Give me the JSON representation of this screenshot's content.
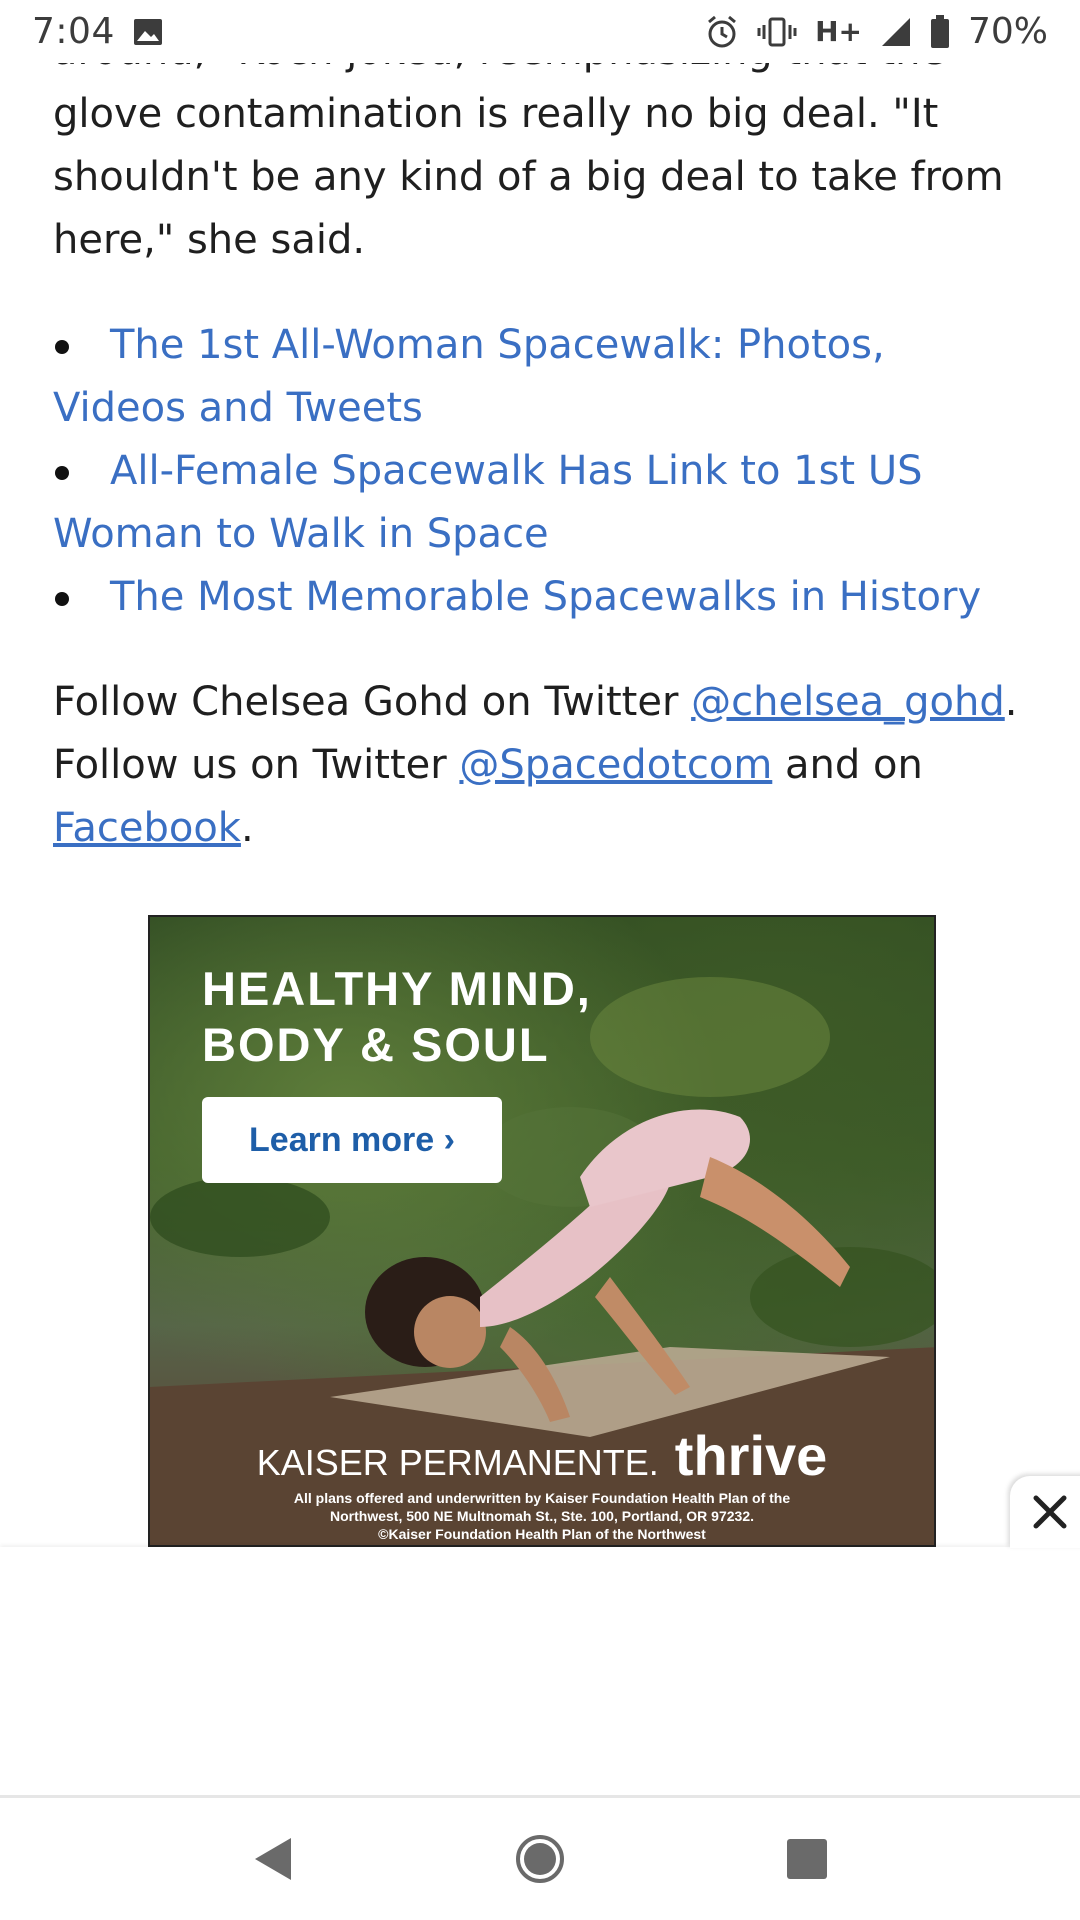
{
  "status_bar": {
    "time": "7:04",
    "battery_percent": "70%",
    "network_label": "H+",
    "icons": [
      "image-icon",
      "alarm-icon",
      "vibrate-icon",
      "signal-icon",
      "battery-icon"
    ]
  },
  "article": {
    "cut_line": "around,\" Koch joked, reemphasizing that the",
    "paragraph_1": "glove contamination is really no big deal. \"It shouldn't be any kind of a big deal to take from here,\" she said.",
    "related_links": [
      "The 1st All-Woman Spacewalk: Photos, Videos and Tweets",
      "All-Female Spacewalk Has Link to 1st US Woman to Walk in Space",
      "The Most Memorable Spacewalks in History"
    ],
    "follow": {
      "prefix_1": "Follow Chelsea Gohd on Twitter ",
      "handle_1": "@chelsea_gohd",
      "suffix_1": ".",
      "prefix_2": " Follow us on Twitter ",
      "handle_2": "@Spacedotcom",
      "middle_2": " and on ",
      "facebook": "Facebook",
      "suffix_2": "."
    }
  },
  "ad": {
    "headline_1": "HEALTHY MIND,",
    "headline_2": "BODY & SOUL",
    "cta_label": "Learn more ›",
    "brand": "KAISER PERMANENTE.",
    "brand_tagline": "thrive",
    "legal_1": "All plans offered and underwritten by Kaiser Foundation Health Plan of the",
    "legal_2": "Northwest, 500 NE Multnomah St., Ste. 100, Portland, OR 97232.",
    "legal_3": "©Kaiser Foundation Health Plan of the Northwest"
  },
  "nav": {
    "icons": [
      "back-icon",
      "home-icon",
      "recents-icon"
    ]
  },
  "colors": {
    "link": "#3a6fc3",
    "text": "#1f1f1f",
    "ad_cta_text": "#1e5ea8"
  }
}
